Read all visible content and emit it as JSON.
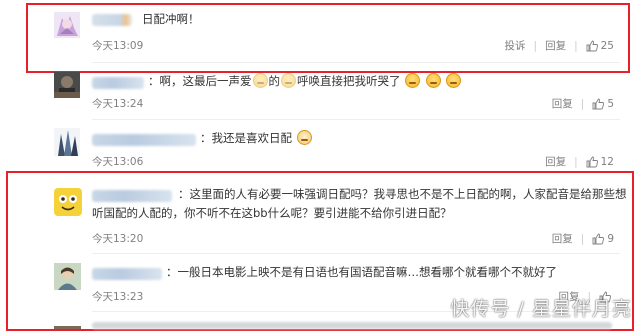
{
  "comments": [
    {
      "text": "日配冲啊！",
      "time": "今天13:09",
      "report_label": "投诉",
      "reply_label": "回复",
      "likes": "25"
    },
    {
      "text_a": "：啊，这最后一声爱",
      "text_b": "的",
      "text_c": "呼唤直接把我听哭了",
      "time": "今天13:24",
      "reply_label": "回复",
      "likes": "5"
    },
    {
      "text": "：我还是喜欢日配",
      "time": "今天13:06",
      "reply_label": "回复",
      "likes": "12"
    },
    {
      "text": "：这里面的人有必要一味强调日配吗？我寻思也不是不上日配的啊，人家配音是给那些想听国配的人配的，你不听不在这bb什么呢？要引进能不给你引进日配？",
      "time": "今天13:20",
      "reply_label": "回复",
      "likes": "9"
    },
    {
      "text": "：一般日本电影上映不是有日语也有国语配音嘛…想看哪个就看哪个不就好了",
      "time": "今天13:23",
      "reply_label": "回复"
    }
  ],
  "watermark": "快传号 / 星星伴月亮",
  "icons": {
    "like": "thumbs-up-icon",
    "emoji": "crying-face-emoji",
    "cat": "cat-face-emoji"
  },
  "colors": {
    "highlight_border": "#e8202a",
    "meta_text": "#808080"
  }
}
